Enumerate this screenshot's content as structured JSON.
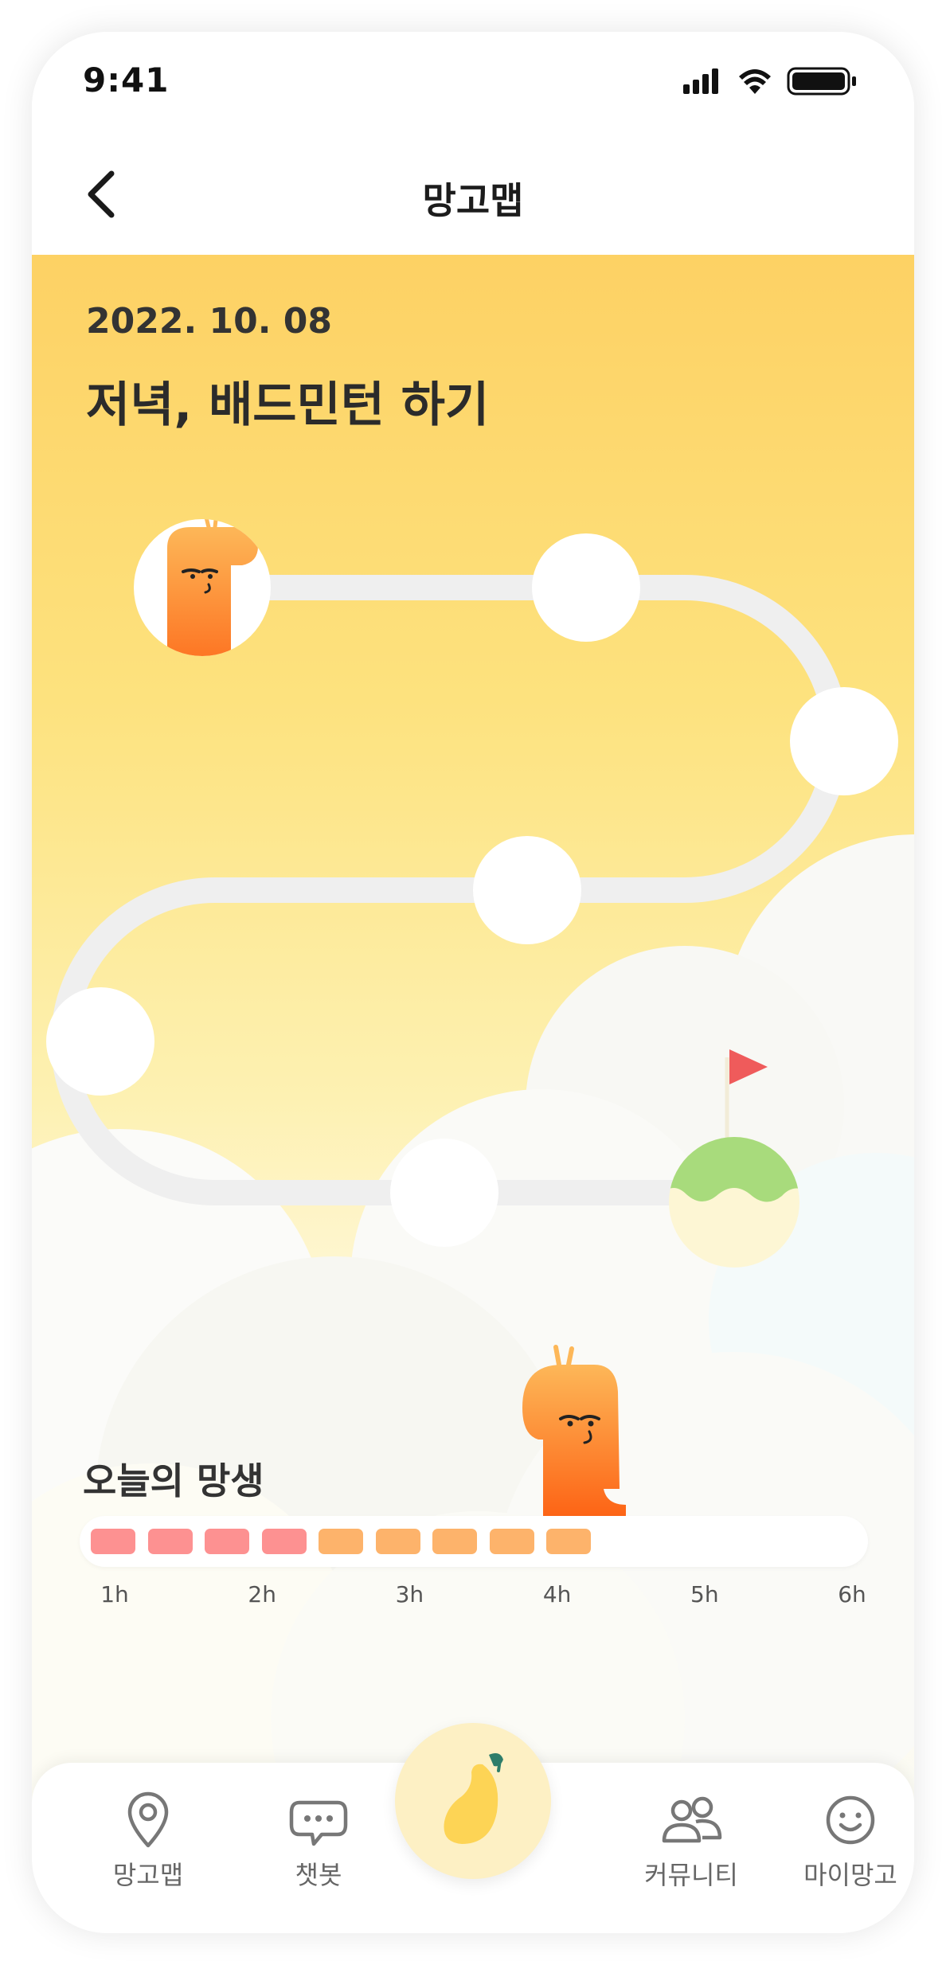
{
  "status_bar": {
    "time": "9:41"
  },
  "nav": {
    "title": "망고맵"
  },
  "plan": {
    "date": "2022. 10. 08",
    "title": "저녁, 배드민턴 하기"
  },
  "progress": {
    "label": "오늘의 망생",
    "filled_segments": 9,
    "total_segments": 18,
    "segment_colors": [
      "#fd9191",
      "#fd9191",
      "#fd9191",
      "#fd9191",
      "#fdb36b",
      "#fdb36b",
      "#fdb36b",
      "#fdb36b",
      "#fdb36b"
    ],
    "ticks": [
      "1h",
      "2h",
      "3h",
      "4h",
      "5h",
      "6h"
    ]
  },
  "tabs": [
    {
      "label": "망고맵",
      "icon": "map-pin-icon"
    },
    {
      "label": "챗봇",
      "icon": "chat-bubble-icon"
    },
    {
      "label": "커뮤니티",
      "icon": "community-icon"
    },
    {
      "label": "마이망고",
      "icon": "smiley-icon"
    }
  ],
  "center_button": {
    "icon": "mango-icon"
  },
  "colors": {
    "accent": "#fdd062",
    "path": "#efefef",
    "flag": "#ef5b5b",
    "goal_top": "#a8db7c"
  }
}
